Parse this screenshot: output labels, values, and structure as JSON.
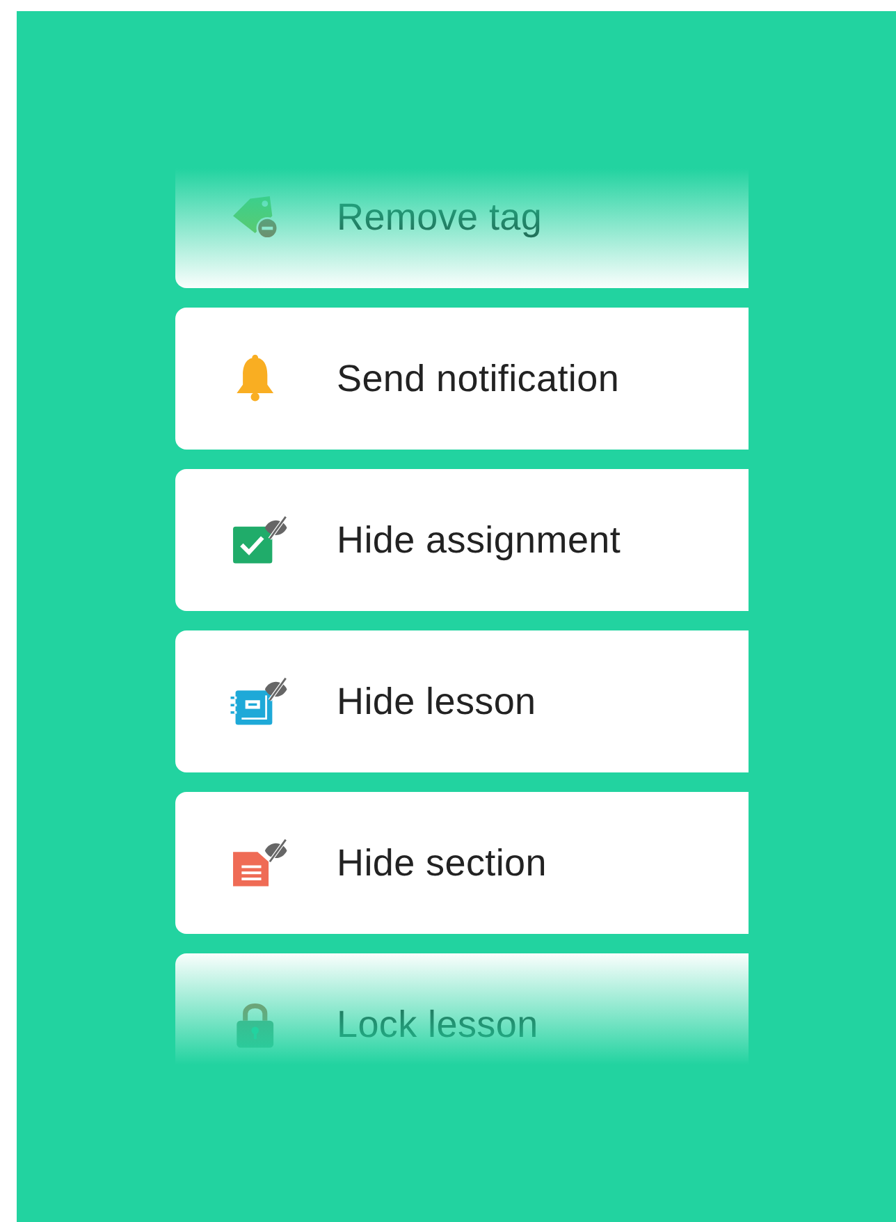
{
  "actions": [
    {
      "label": "Remove tag"
    },
    {
      "label": "Send notification"
    },
    {
      "label": "Hide assignment"
    },
    {
      "label": "Hide lesson"
    },
    {
      "label": "Hide section"
    },
    {
      "label": "Lock lesson"
    }
  ]
}
